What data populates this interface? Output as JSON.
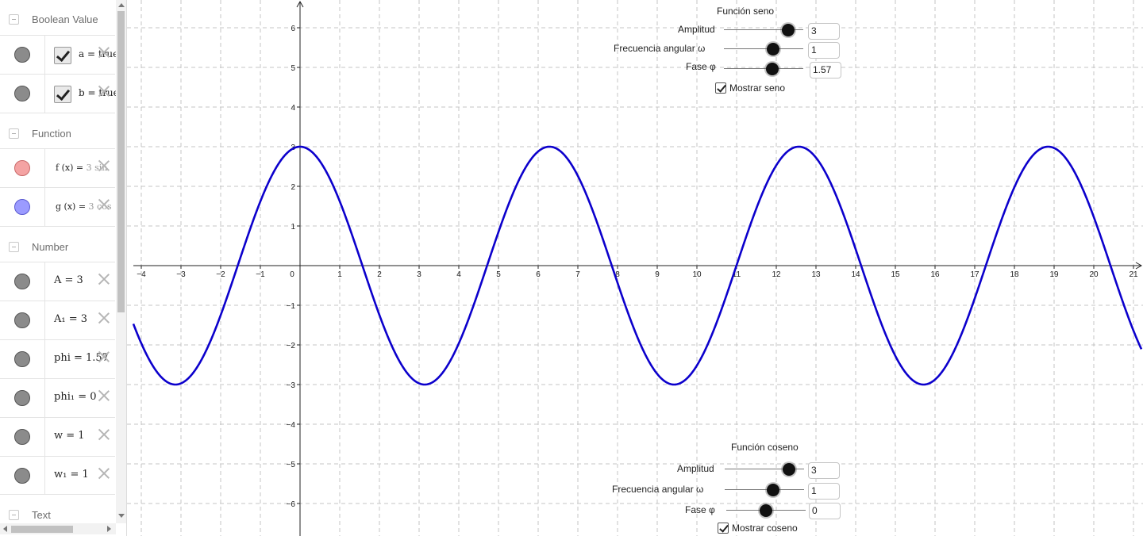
{
  "algebra_view": {
    "categories": {
      "boolean": "Boolean Value",
      "function": "Function",
      "number": "Number",
      "text": "Text"
    },
    "booleans": [
      {
        "name": "a",
        "display": "a = true"
      },
      {
        "name": "b",
        "display": "b = true"
      }
    ],
    "functions": [
      {
        "name": "f",
        "lhs": "f (x) =",
        "rhs": "3 sin",
        "color": "#f08a8a"
      },
      {
        "name": "g",
        "lhs": "g (x) =",
        "rhs": "3 cos",
        "color": "#8a8aff"
      }
    ],
    "numbers": [
      {
        "display": "A = 3"
      },
      {
        "display": "A₁ = 3"
      },
      {
        "display": "phi = 1.57"
      },
      {
        "display": "phi₁ = 0"
      },
      {
        "display": "w = 1"
      },
      {
        "display": "w₁ = 1"
      }
    ]
  },
  "sine_panel": {
    "title": "Función seno",
    "amplitude_label": "Amplitud",
    "amplitude_value": "3",
    "frequency_label": "Frecuencia angular ω",
    "frequency_value": "1",
    "phase_label": "Fase φ",
    "phase_value": "1.57",
    "show_label": "Mostrar seno"
  },
  "cosine_panel": {
    "title": "Función coseno",
    "amplitude_label": "Amplitud",
    "amplitude_value": "3",
    "frequency_label": "Frecuencia angular ω",
    "frequency_value": "1",
    "phase_label": "Fase φ",
    "phase_value": "0",
    "show_label": "Mostrar coseno"
  },
  "chart_data": {
    "type": "line",
    "title": "",
    "xlabel": "",
    "ylabel": "",
    "xlim": [
      -4.2,
      21.2
    ],
    "ylim": [
      -6.8,
      6.7
    ],
    "grid": true,
    "x_ticks": [
      "−4",
      "−3",
      "−2",
      "−1",
      "0",
      "1",
      "2",
      "3",
      "4",
      "5",
      "6",
      "7",
      "8",
      "9",
      "10",
      "11",
      "12",
      "13",
      "14",
      "15",
      "16",
      "17",
      "18",
      "19",
      "20",
      "21"
    ],
    "y_ticks": [
      "6",
      "5",
      "4",
      "3",
      "2",
      "1",
      "−1",
      "−2",
      "−3",
      "−4",
      "−5",
      "−6"
    ],
    "series": [
      {
        "amplitude": 3,
        "angular_frequency": 1,
        "phase": 1.57,
        "function": "sine",
        "color": "#0c00cc"
      }
    ]
  }
}
